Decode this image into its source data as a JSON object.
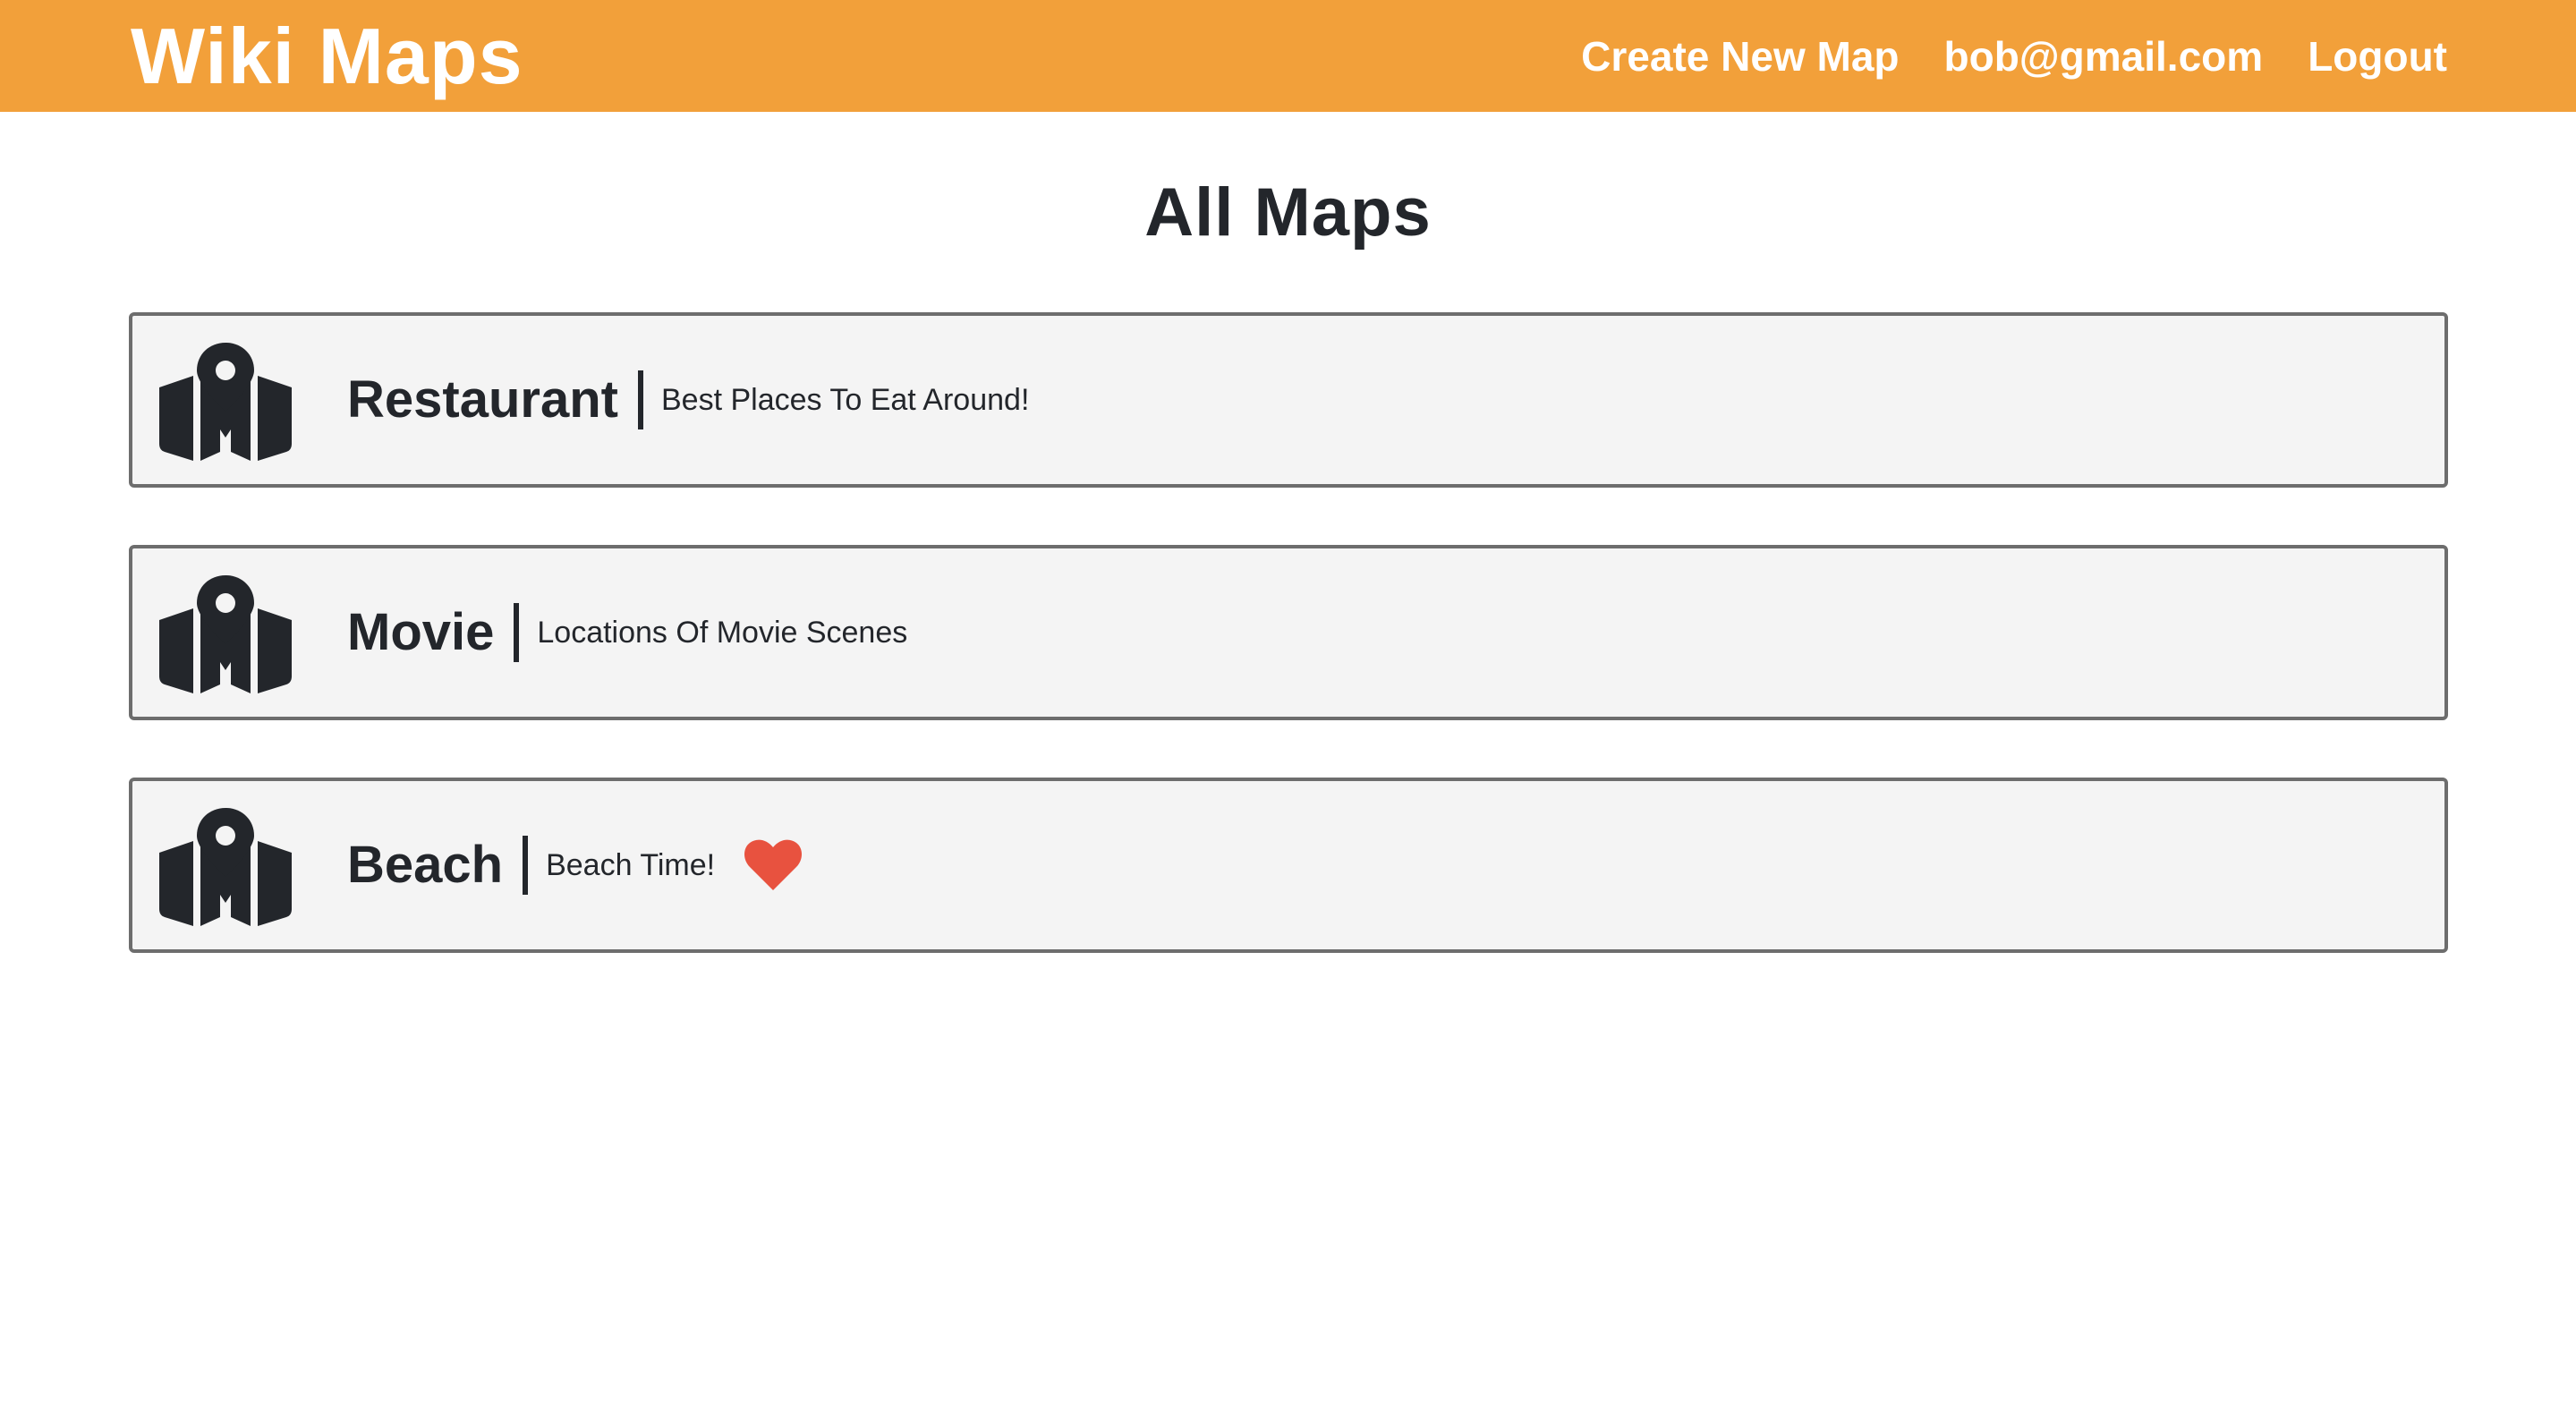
{
  "header": {
    "brand": "Wiki Maps",
    "nav": {
      "create_label": "Create New Map",
      "user_email": "bob@gmail.com",
      "logout_label": "Logout"
    }
  },
  "main": {
    "title": "All Maps",
    "maps": [
      {
        "name": "Restaurant",
        "description": "Best Places To Eat Around!",
        "icon": "map-marker-icon",
        "favorited": false
      },
      {
        "name": "Movie",
        "description": "Locations Of Movie Scenes",
        "icon": "map-marker-icon",
        "favorited": false
      },
      {
        "name": "Beach",
        "description": "Beach Time!",
        "icon": "map-marker-icon",
        "favorited": true,
        "favorite_icon": "heart-icon"
      }
    ]
  },
  "colors": {
    "header_bg": "#f2a03a",
    "card_bg": "#f4f4f4",
    "card_border": "#6d6d6d",
    "text": "#23262b",
    "heart": "#e8523f"
  }
}
